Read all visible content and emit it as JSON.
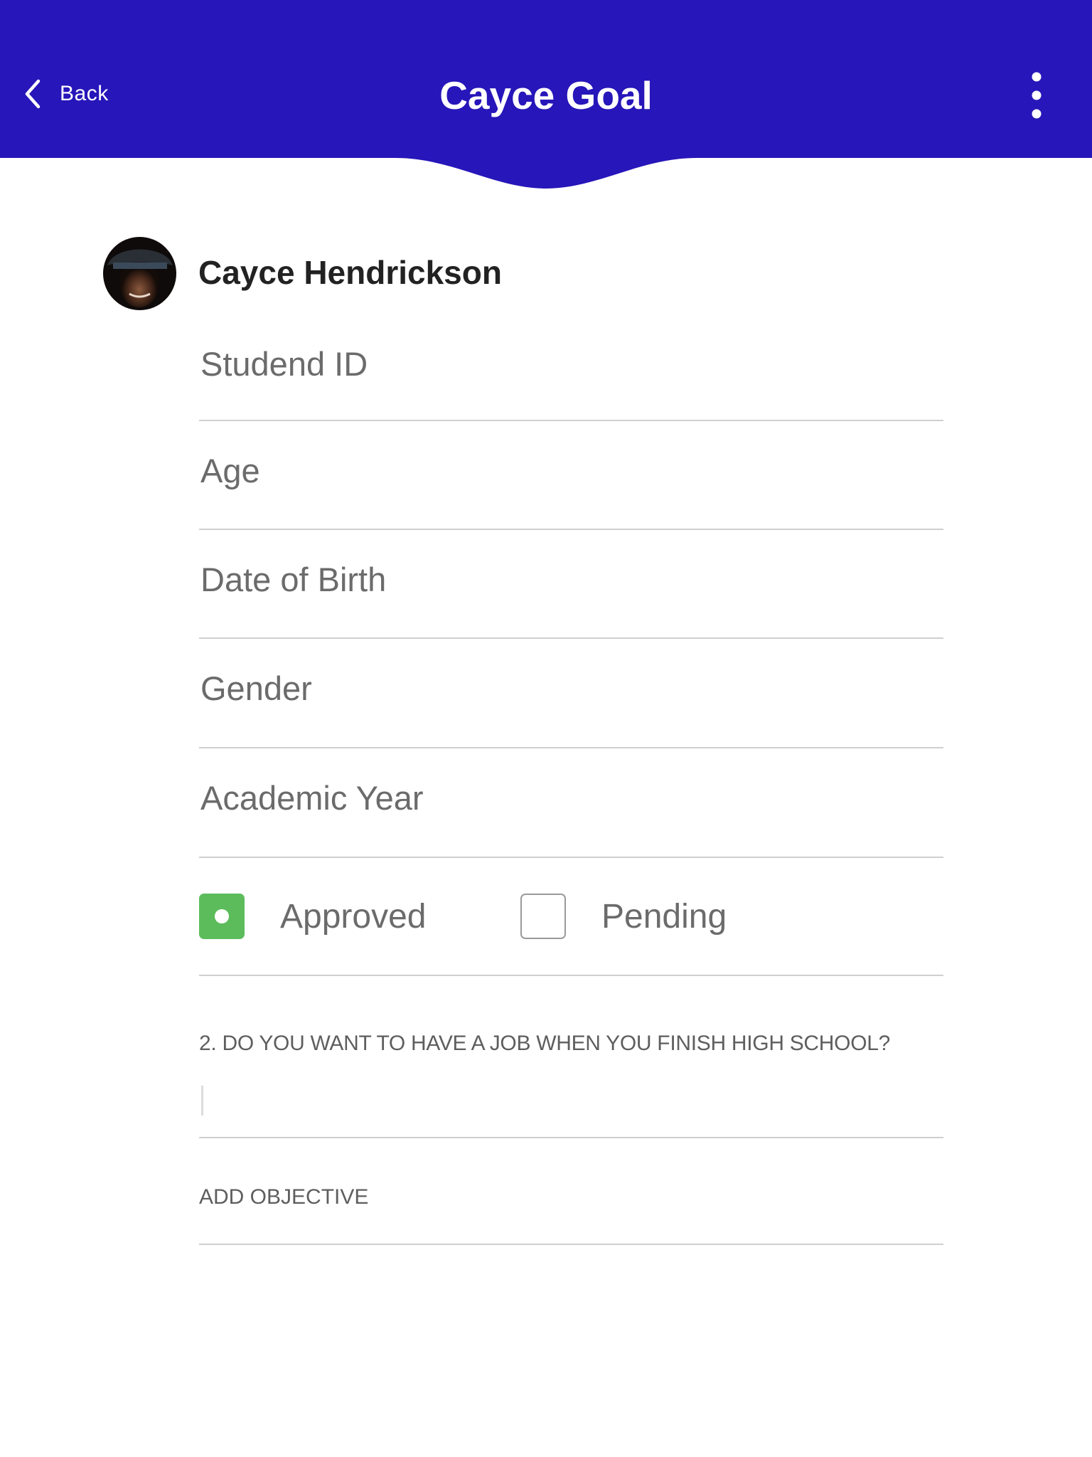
{
  "colors": {
    "header_bg": "#2716b9",
    "approved_green": "#5cbc5c",
    "label_gray": "#6b6b6b"
  },
  "header": {
    "back_label": "Back",
    "title": "Cayce Goal",
    "back_icon": "chevron-left-icon",
    "more_icon": "more-vertical-icon"
  },
  "profile": {
    "name": "Cayce Hendrickson"
  },
  "fields": {
    "student_id": "Studend ID",
    "age": "Age",
    "date_of_birth": "Date of Birth",
    "gender": "Gender",
    "academic_year": "Academic Year"
  },
  "status": {
    "approved": {
      "label": "Approved",
      "checked": true
    },
    "pending": {
      "label": "Pending",
      "checked": false
    }
  },
  "question": {
    "label": "2. DO YOU WANT TO HAVE A JOB WHEN YOU FINISH HIGH SCHOOL?",
    "answer": ""
  },
  "add_objective": {
    "label": "ADD OBJECTIVE"
  }
}
